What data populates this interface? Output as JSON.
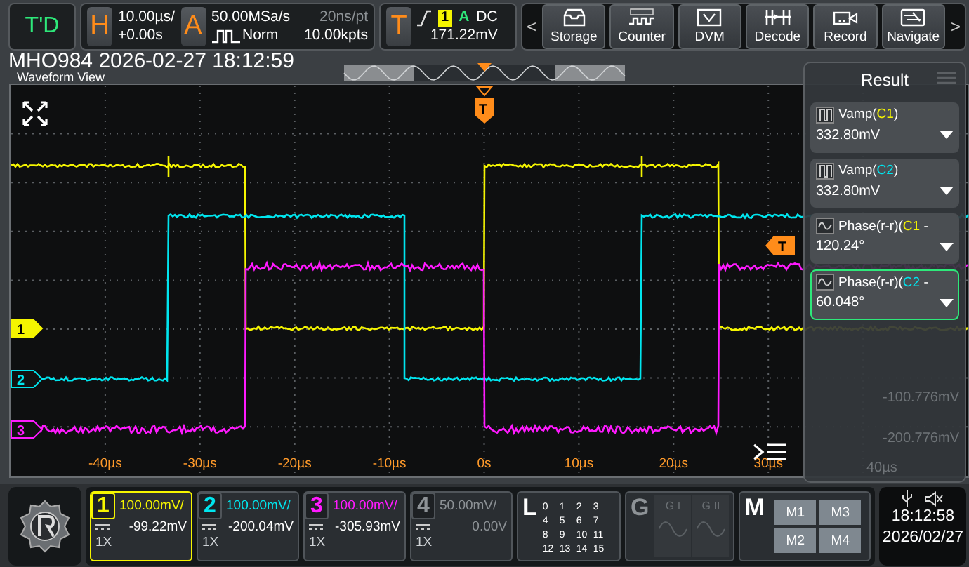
{
  "trigger_status": "T'D",
  "horizontal": {
    "label": "H",
    "scale": "10.00µs/",
    "position": "+0.00s"
  },
  "acquire": {
    "label": "A",
    "sample_rate": "50.00MSa/s",
    "mode": "Norm",
    "resolution": "20ns/pt",
    "memory_depth": "10.00kpts"
  },
  "trigger": {
    "label": "T",
    "source": "1",
    "type": "A",
    "coupling": "DC",
    "level": "171.22mV"
  },
  "toolbar": {
    "prev": "<",
    "next": ">",
    "buttons": [
      {
        "label": "Storage"
      },
      {
        "label": "Counter"
      },
      {
        "label": "DVM"
      },
      {
        "label": "Decode"
      },
      {
        "label": "Record"
      },
      {
        "label": "Navigate"
      }
    ]
  },
  "caption": "MHO984 2026-02-27 18:12:59",
  "waveform_view": {
    "title": "Waveform View",
    "trigger_marker": "T",
    "level_marker": "T",
    "time_labels": [
      "-40µs",
      "-30µs",
      "-20µs",
      "-10µs",
      "0s",
      "10µs",
      "20µs",
      "30µs"
    ]
  },
  "result_panel": {
    "title": "Result",
    "measurements": [
      {
        "name": "Vamp(",
        "source": "C1",
        "suffix": ")",
        "color": "#f5f500",
        "value": "332.80mV",
        "selected": false
      },
      {
        "name": "Vamp(",
        "source": "C2",
        "suffix": ")",
        "color": "#00e5ee",
        "value": "332.80mV",
        "selected": false
      },
      {
        "name": "Phase(r-r)(",
        "source": "C1",
        "suffix": " -",
        "color": "#f5f500",
        "value": "120.24°",
        "selected": false
      },
      {
        "name": "Phase(r-r)(",
        "source": "C2",
        "suffix": " -",
        "color": "#00e5ee",
        "value": "60.048°",
        "selected": true
      }
    ],
    "background_labels": [
      "-100.776mV",
      "-200.776mV",
      "40µs"
    ]
  },
  "channels": [
    {
      "number": "1",
      "marker_label": "1",
      "color": "#f5f500",
      "scale": "100.00mV/",
      "offset": "-99.22mV",
      "probe": "1X",
      "selected": true,
      "enabled": true
    },
    {
      "number": "2",
      "marker_label": "2",
      "color": "#00e5ee",
      "scale": "100.00mV/",
      "offset": "-200.04mV",
      "probe": "1X",
      "selected": false,
      "enabled": true
    },
    {
      "number": "3",
      "marker_label": "3",
      "color": "#ff1aff",
      "scale": "100.00mV/",
      "offset": "-305.93mV",
      "probe": "1X",
      "selected": false,
      "enabled": true
    },
    {
      "number": "4",
      "color": "#8d9296",
      "scale": "50.00mV/",
      "offset": "0.00V",
      "probe": "1X",
      "selected": false,
      "enabled": false
    }
  ],
  "logic": {
    "label": "L",
    "bits": [
      "0",
      "1",
      "2",
      "3",
      "4",
      "5",
      "6",
      "7",
      "8",
      "9",
      "10",
      "11",
      "12",
      "13",
      "14",
      "15"
    ]
  },
  "generator": {
    "label": "G",
    "enabled": false,
    "outputs": [
      "G I",
      "G II"
    ]
  },
  "math": {
    "label": "M",
    "items": [
      "M1",
      "M3",
      "M2",
      "M4"
    ]
  },
  "status": {
    "time": "18:12:58",
    "date": "2026/02/27"
  }
}
